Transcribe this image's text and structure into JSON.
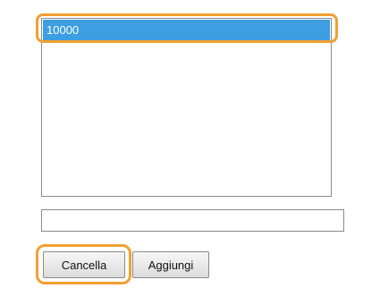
{
  "list": {
    "items": [
      {
        "label": "10000",
        "selected": true
      }
    ],
    "selection_color": "#3d9ee2"
  },
  "input": {
    "value": "",
    "placeholder": ""
  },
  "buttons": {
    "cancel_label": "Cancella",
    "add_label": "Aggiungi"
  },
  "colors": {
    "highlight_ring": "#f2a030"
  }
}
